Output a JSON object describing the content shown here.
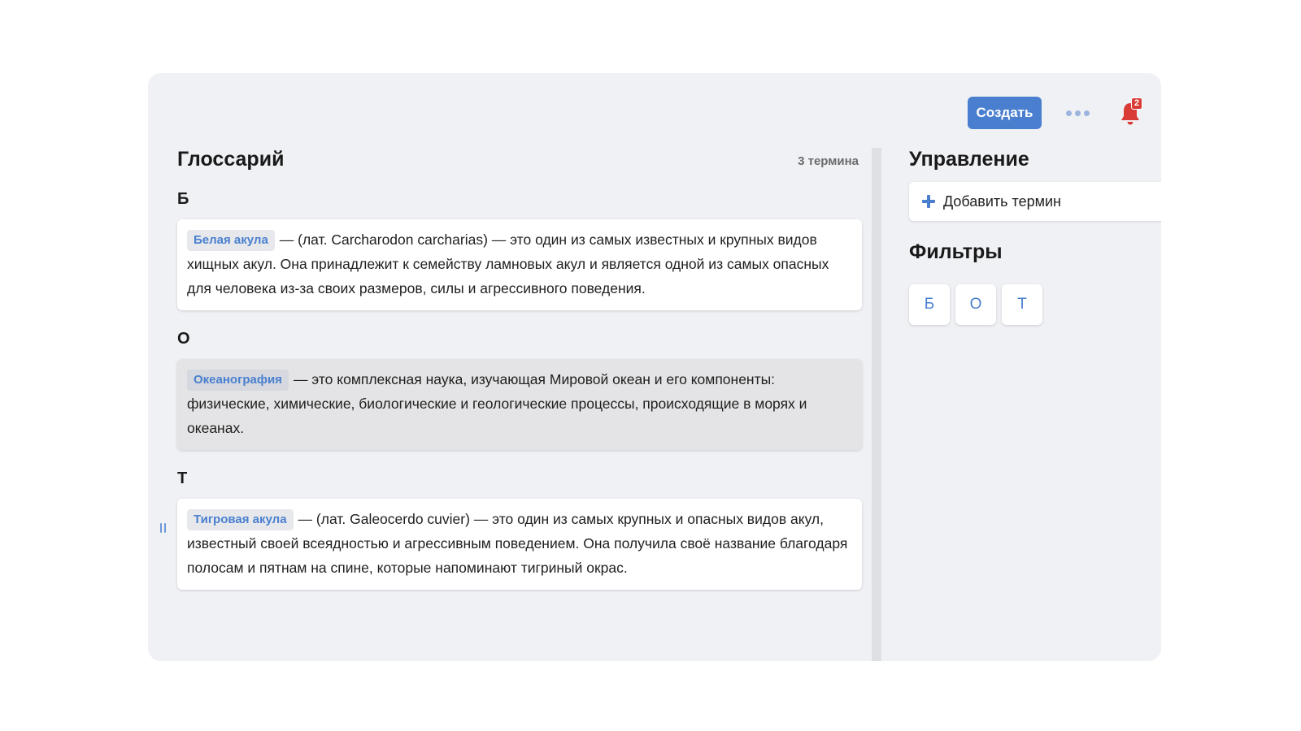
{
  "header": {
    "create_label": "Создать",
    "more_icon": "more-horizontal-icon",
    "bell_icon": "bell-icon",
    "notifications_count": "2",
    "colors": {
      "accent": "#4a7fcf",
      "badge": "#d93b36"
    }
  },
  "glossary": {
    "title": "Глоссарий",
    "count_label": "3 термина",
    "sections": [
      {
        "letter": "Б",
        "term": "Белая акула",
        "definition": "— (лат. Carcharodon carcharias) — это один из самых известных и крупных видов хищных акул. Она принадлежит к семейству ламновых акул и является одной из самых опасных для человека из-за своих размеров, силы и агрессивного поведения."
      },
      {
        "letter": "О",
        "term": "Океанография",
        "definition": "— это комплексная наука, изучающая Мировой океан и его компоненты: физические, химические, биологические и геологические процессы, происходящие в морях и океанах."
      },
      {
        "letter": "Т",
        "term": "Тигровая акула",
        "definition": "— (лат. Galeocerdo cuvier) — это один из самых крупных и опасных видов акул, известный своей всеядностью и агрессивным поведением. Она получила своё название благодаря полосам и пятнам на спине, которые напоминают тигриный окрас."
      }
    ]
  },
  "sidebar": {
    "manage_title": "Управление",
    "add_term_label": "Добавить термин",
    "filters_title": "Фильтры",
    "filters": [
      "Б",
      "О",
      "Т"
    ]
  }
}
